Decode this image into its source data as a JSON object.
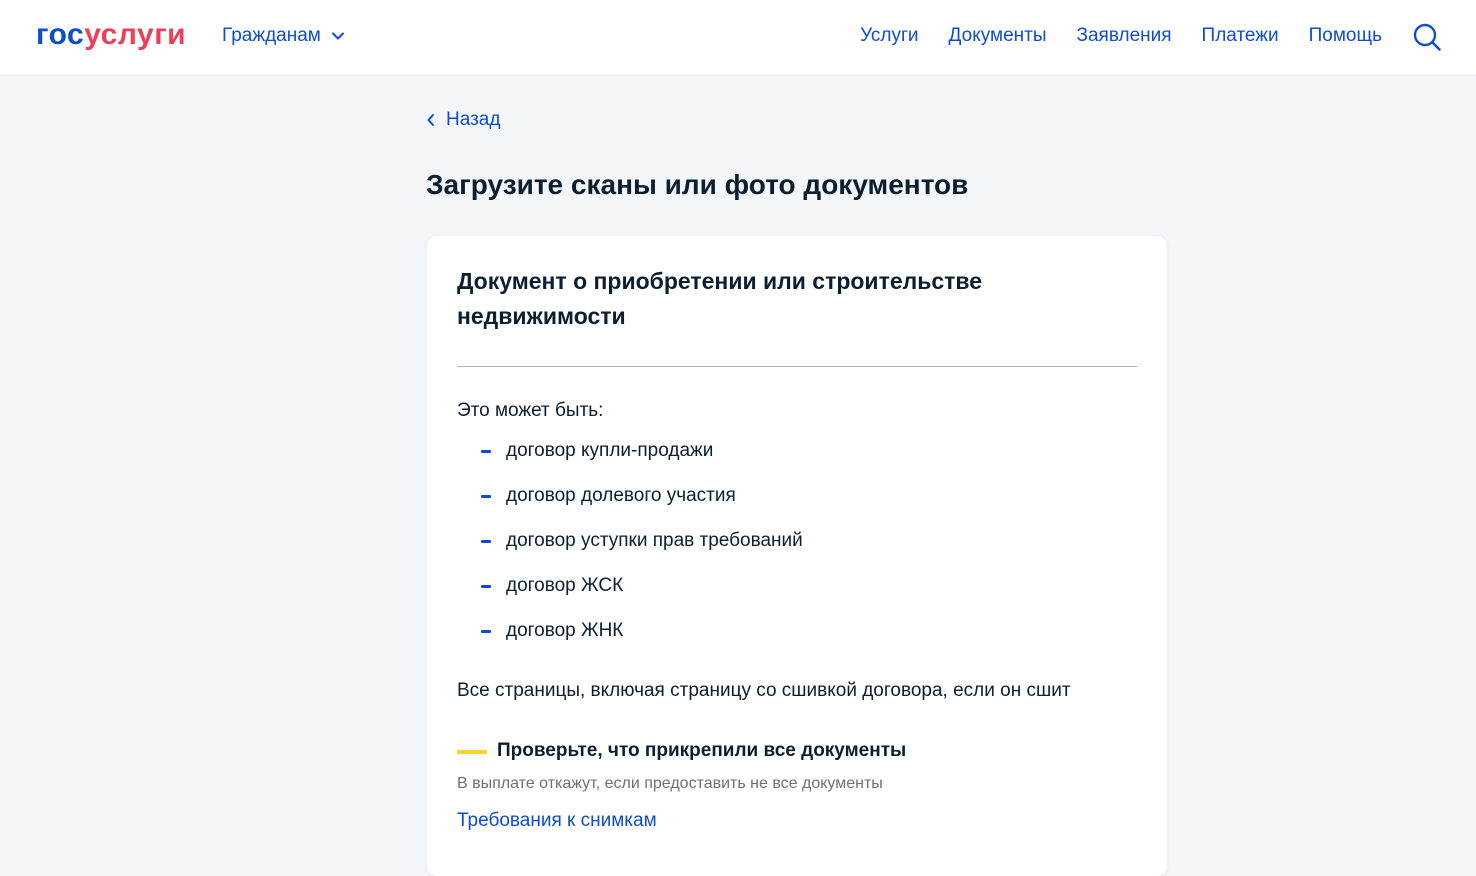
{
  "header": {
    "logo_part1": "гос",
    "logo_part2": "услуги",
    "role": "Гражданам",
    "nav": [
      "Услуги",
      "Документы",
      "Заявления",
      "Платежи",
      "Помощь"
    ]
  },
  "back_label": "Назад",
  "page_title": "Загрузите сканы или фото документов",
  "card": {
    "title": "Документ о приобретении или строительстве недвижимости",
    "intro": "Это может быть:",
    "items": [
      "договор купли-продажи",
      "договор долевого участия",
      "договор уступки прав требований",
      "договор ЖСК",
      "договор ЖНК"
    ],
    "all_pages": "Все страницы, включая страницу со сшивкой договора, если он сшит",
    "warning_title": "Проверьте, что прикрепили все документы",
    "warning_text": "В выплате откажут, если предоставить не все документы",
    "requirements_link": "Требования к снимкам"
  },
  "icons": {
    "role_chevron": "chevron-down-icon",
    "search": "search-icon",
    "back": "chevron-left-icon"
  },
  "colors": {
    "primary": "#0d4cd3",
    "logo_red": "#ee3f58",
    "warning": "#fcd333",
    "background": "#f4f6fa"
  }
}
